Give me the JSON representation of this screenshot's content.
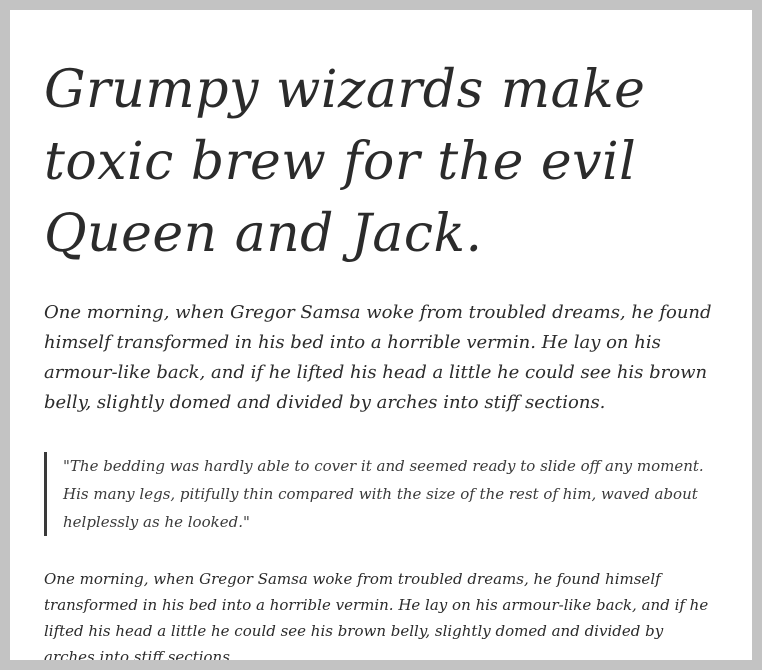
{
  "document": {
    "headline": "Grumpy wizards make toxic brew for the evil Queen and Jack.",
    "paragraph1": "One morning, when Gregor Samsa woke from troubled dreams, he found himself transformed in his bed into a horrible vermin. He lay on his armour-like back, and if he lifted his head a little he could see his brown belly, slightly domed and divided by arches into stiff sections.",
    "blockquote": "\"The bedding was hardly able to cover it and seemed ready to slide off any moment. His many legs, pitifully thin compared with the size of the rest of him, waved about helplessly as he looked.\"",
    "paragraph2": "One morning, when Gregor Samsa woke from troubled dreams, he found himself transformed in his bed into a horrible vermin. He lay on his armour-like back, and if he lifted his head a little he could see his brown belly, slightly domed and divided by arches into stiff sections."
  }
}
